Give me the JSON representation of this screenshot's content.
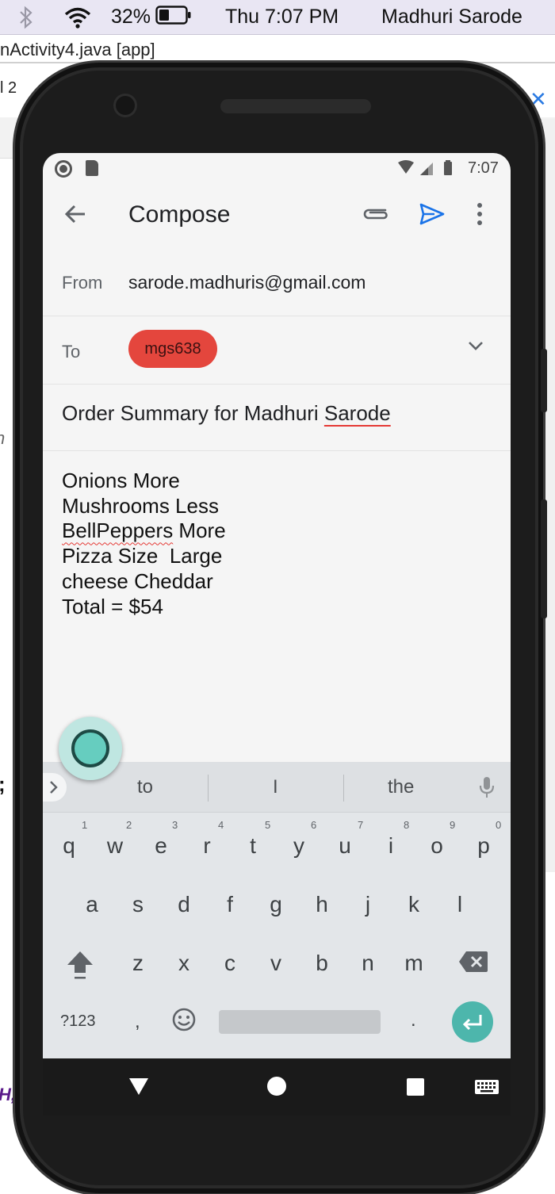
{
  "menubar": {
    "battery_pct": "32%",
    "time": "Thu 7:07 PM",
    "user": "Madhuri Sarode"
  },
  "ide": {
    "tab_label": "nActivity4.java [app]",
    "fragment_row2": "l 2",
    "fragment_left1": "n",
    "fragment_left2": ";",
    "fragment_left3": "H,"
  },
  "android_status": {
    "time": "7:07"
  },
  "compose": {
    "title": "Compose",
    "from_label": "From",
    "from_value": "sarode.madhuris@gmail.com",
    "to_label": "To",
    "to_chip": "mgs638",
    "subject_prefix": "Order Summary for Madhuri ",
    "subject_misspelled": "Sarode",
    "body_line1": "Onions More",
    "body_line2": "Mushrooms Less",
    "body_line3_misspelled": "BellPeppers",
    "body_line3_rest": " More",
    "body_line4": "Pizza Size  Large",
    "body_line5": "cheese Cheddar",
    "body_line6": "Total = $54"
  },
  "keyboard": {
    "suggestions": [
      "to",
      "I",
      "the"
    ],
    "row1": [
      "q",
      "w",
      "e",
      "r",
      "t",
      "y",
      "u",
      "i",
      "o",
      "p"
    ],
    "row1_digits": [
      "1",
      "2",
      "3",
      "4",
      "5",
      "6",
      "7",
      "8",
      "9",
      "0"
    ],
    "row2": [
      "a",
      "s",
      "d",
      "f",
      "g",
      "h",
      "j",
      "k",
      "l"
    ],
    "row3": [
      "z",
      "x",
      "c",
      "v",
      "b",
      "n",
      "m"
    ],
    "symbols_key": "?123",
    "comma_key": ",",
    "period_key": "."
  },
  "colors": {
    "chip": "#e4463d",
    "send_icon": "#1a73e8",
    "enter_key": "#4db6ac",
    "assistant": "#66cdbf"
  },
  "icons": [
    "bluetooth-icon",
    "wifi-icon",
    "battery-icon",
    "back-arrow-icon",
    "attach-icon",
    "send-icon",
    "more-vert-icon",
    "chevron-down-icon",
    "mic-icon",
    "shift-icon",
    "backspace-icon",
    "emoji-icon",
    "enter-icon",
    "nav-back-icon",
    "nav-home-icon",
    "nav-recents-icon",
    "keyboard-icon"
  ]
}
